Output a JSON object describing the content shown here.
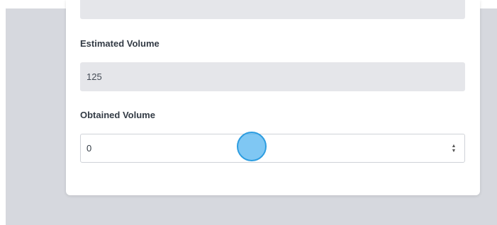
{
  "form": {
    "estimated_volume": {
      "label": "Estimated Volume",
      "value": "125"
    },
    "obtained_volume": {
      "label": "Obtained Volume",
      "value": "0",
      "stepper_up_icon": "▲",
      "stepper_down_icon": "▼"
    }
  },
  "colors": {
    "page_background": "#d6d8de",
    "card_background": "#ffffff",
    "readonly_field": "#e5e6ea",
    "cursor_fill": "#4eb2ee",
    "cursor_border": "#2d9de0"
  }
}
